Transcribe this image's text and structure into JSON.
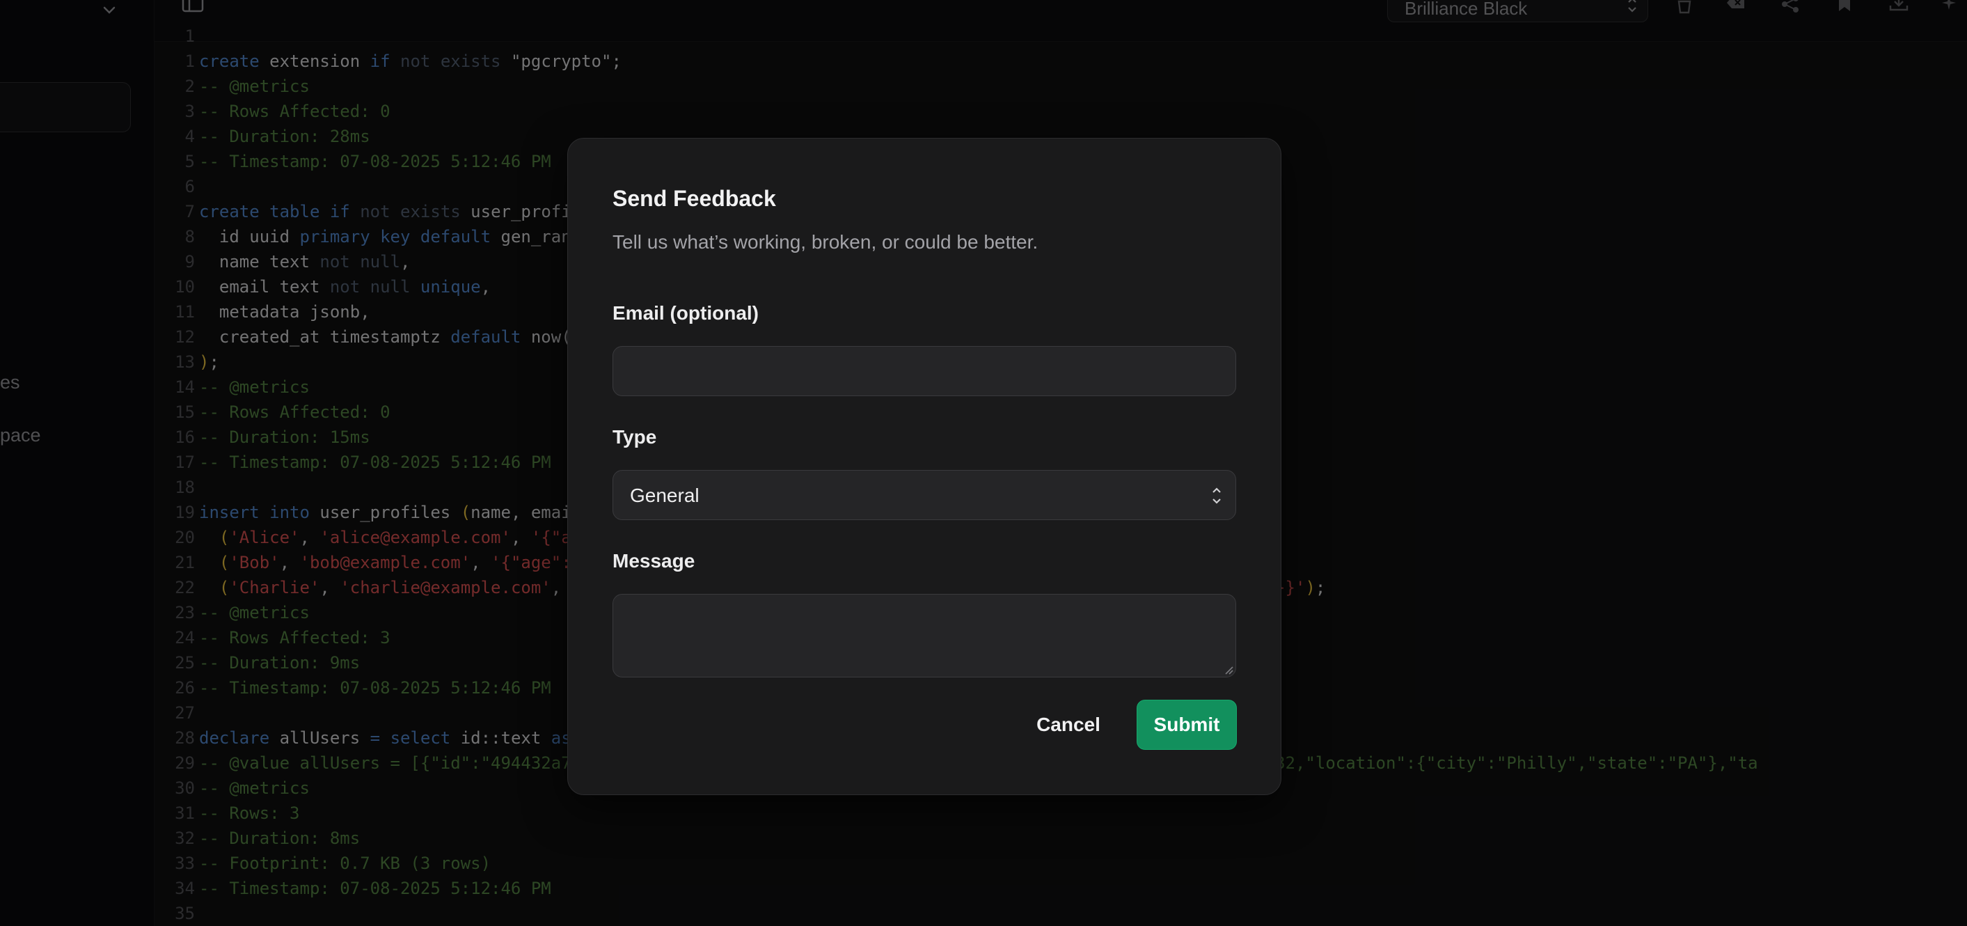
{
  "sidebar": {
    "items": [
      {
        "label": "es"
      },
      {
        "label": "pace"
      }
    ]
  },
  "toolbar": {
    "theme_select": {
      "value": "Brilliance Black"
    },
    "icons": [
      "trash-icon",
      "clear-icon",
      "share-icon",
      "bookmark-icon",
      "download-icon",
      "sparkle-icon"
    ]
  },
  "editor": {
    "lines": [
      {
        "n": "1",
        "text": ""
      },
      {
        "n": "1",
        "html": "<span class='kw'>create</span> extension <span class='kw'>if</span> <span class='kd'>not exists</span> \"pgcrypto\";"
      },
      {
        "n": "2",
        "html": "<span class='cm'>-- @metrics</span>"
      },
      {
        "n": "3",
        "html": "<span class='cm'>-- Rows Affected: 0</span>"
      },
      {
        "n": "4",
        "html": "<span class='cm'>-- Duration: 28ms</span>"
      },
      {
        "n": "5",
        "html": "<span class='cm'>-- Timestamp: 07-08-2025 5:12:46 PM</span>"
      },
      {
        "n": "6",
        "html": ""
      },
      {
        "n": "7",
        "html": "<span class='kw'>create</span> <span class='kw'>table</span> <span class='kw'>if</span> <span class='kd'>not exists</span> user_profi"
      },
      {
        "n": "8",
        "html": "  id uuid <span class='kw'>primary key</span> <span class='kw'>default</span> gen_ran"
      },
      {
        "n": "9",
        "html": "  name text <span class='kd'>not null</span>,"
      },
      {
        "n": "10",
        "html": "  email text <span class='kd'>not null</span> <span class='kw'>unique</span>,"
      },
      {
        "n": "11",
        "html": "  metadata jsonb,"
      },
      {
        "n": "12",
        "html": "  created_at timestamptz <span class='kw'>default</span> now("
      },
      {
        "n": "13",
        "html": "<span class='pn'>)</span>;"
      },
      {
        "n": "14",
        "html": "<span class='cm'>-- @metrics</span>"
      },
      {
        "n": "15",
        "html": "<span class='cm'>-- Rows Affected: 0</span>"
      },
      {
        "n": "16",
        "html": "<span class='cm'>-- Duration: 15ms</span>"
      },
      {
        "n": "17",
        "html": "<span class='cm'>-- Timestamp: 07-08-2025 5:12:46 PM</span>"
      },
      {
        "n": "18",
        "html": ""
      },
      {
        "n": "19",
        "html": "<span class='kw'>insert</span> <span class='kw'>into</span> user_profiles <span class='pn'>(</span>name, emai"
      },
      {
        "n": "20",
        "html": "  <span class='pn'>(</span><span class='st'>'Alice'</span>, <span class='st'>'alice@example.com'</span>, <span class='st'>'{\"a                                                       ate\": \"PA\"}}'</span><span class='pn'>)</span>,"
      },
      {
        "n": "21",
        "html": "  <span class='pn'>(</span><span class='st'>'Bob'</span>, <span class='st'>'bob@example.com'</span>, <span class='st'>'{\"age\":                                                             '</span><span class='pn'>)</span>,"
      },
      {
        "n": "22",
        "html": "  <span class='pn'>(</span><span class='st'>'Charlie'</span>, <span class='st'>'charlie@example.com'</span>,                                                     <span class='st'>go\", \"state\": \"IL\"}}'</span><span class='pn'>)</span>;"
      },
      {
        "n": "23",
        "html": "<span class='cm'>-- @metrics</span>"
      },
      {
        "n": "24",
        "html": "<span class='cm'>-- Rows Affected: 3</span>"
      },
      {
        "n": "25",
        "html": "<span class='cm'>-- Duration: 9ms</span>"
      },
      {
        "n": "26",
        "html": "<span class='cm'>-- Timestamp: 07-08-2025 5:12:46 PM</span>"
      },
      {
        "n": "27",
        "html": ""
      },
      {
        "n": "28",
        "html": "<span class='kw'>declare</span> allUsers <span class='kw'>=</span> <span class='kw'>select</span> id::text <span class='kw'>as</span>"
      },
      {
        "n": "29",
        "html": "<span class='cm'>-- @value allUsers = [{\"id\":\"494432a7                                                 n\",\"metadata\":{\"age\":32,\"location\":{\"city\":\"Philly\",\"state\":\"PA\"},\"ta</span>"
      },
      {
        "n": "30",
        "html": "<span class='cm'>-- @metrics</span>"
      },
      {
        "n": "31",
        "html": "<span class='cm'>-- Rows: 3</span>"
      },
      {
        "n": "32",
        "html": "<span class='cm'>-- Duration: 8ms</span>"
      },
      {
        "n": "33",
        "html": "<span class='cm'>-- Footprint: 0.7 KB (3 rows)</span>"
      },
      {
        "n": "34",
        "html": "<span class='cm'>-- Timestamp: 07-08-2025 5:12:46 PM</span>"
      },
      {
        "n": "35",
        "html": ""
      }
    ]
  },
  "dialog": {
    "title": "Send Feedback",
    "description": "Tell us what’s working, broken, or could be better.",
    "email_label": "Email (optional)",
    "email_value": "",
    "type_label": "Type",
    "type_value": "General",
    "message_label": "Message",
    "message_value": "",
    "cancel_label": "Cancel",
    "submit_label": "Submit"
  },
  "colors": {
    "background": "#0e0e0f",
    "dialog_bg": "#1a1a1b",
    "submit_bg": "#12905d",
    "keyword": "#4c7fc0",
    "comment": "#4f7a3e",
    "string": "#c94a4a"
  }
}
